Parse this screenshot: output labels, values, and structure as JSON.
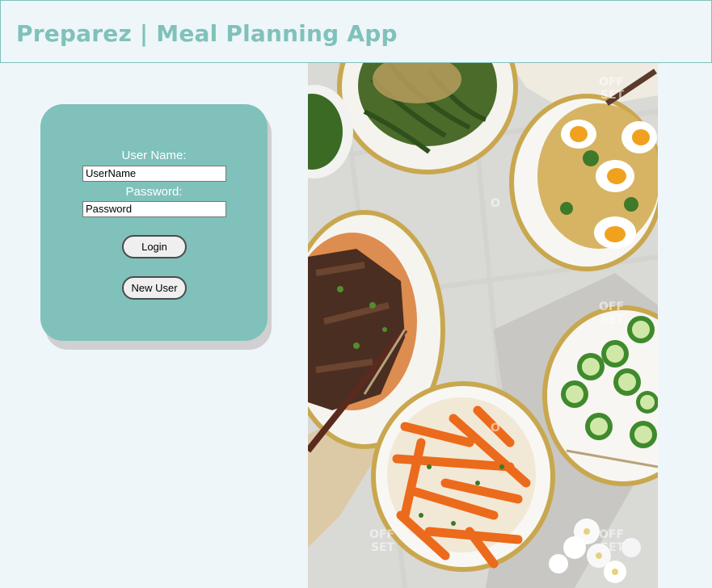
{
  "header": {
    "title": "Preparez | Meal Planning App"
  },
  "login": {
    "username_label": "User Name:",
    "username_value": "UserName",
    "password_label": "Password:",
    "password_value": "Password",
    "login_button": "Login",
    "new_user_button": "New User"
  },
  "hero": {
    "watermarks": [
      "OFF",
      "SET",
      "O",
      "OFF",
      "SET",
      "O",
      "OFF",
      "SET",
      "OFF",
      "SET"
    ]
  },
  "colors": {
    "accent": "#80c1bb",
    "background": "#eef6f9"
  }
}
